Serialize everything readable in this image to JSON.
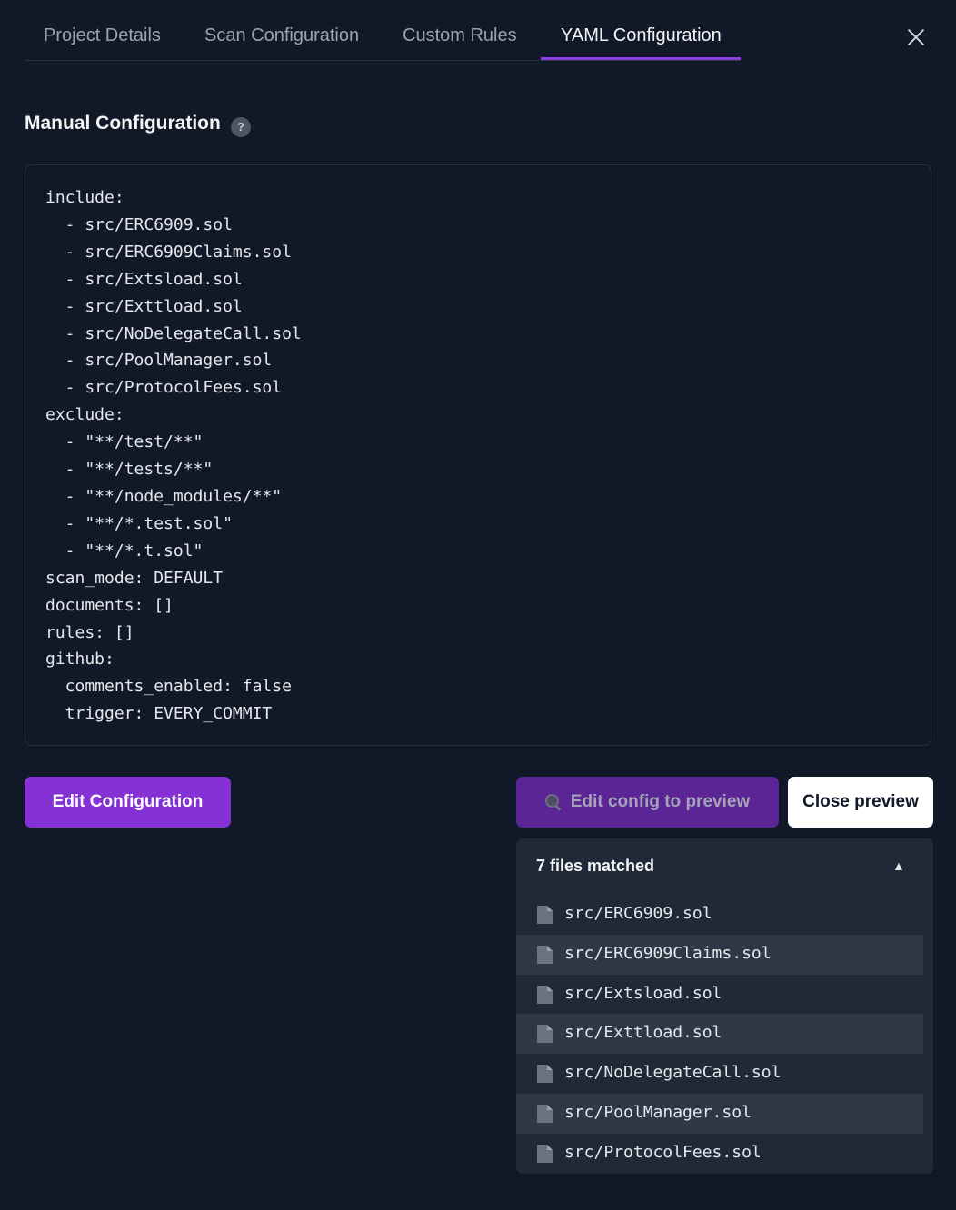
{
  "tabs": [
    {
      "label": "Project Details",
      "active": false
    },
    {
      "label": "Scan Configuration",
      "active": false
    },
    {
      "label": "Custom Rules",
      "active": false
    },
    {
      "label": "YAML Configuration",
      "active": true
    }
  ],
  "section": {
    "title": "Manual Configuration",
    "help_icon_label": "?"
  },
  "yaml_code": "include:\n  - src/ERC6909.sol\n  - src/ERC6909Claims.sol\n  - src/Extsload.sol\n  - src/Exttload.sol\n  - src/NoDelegateCall.sol\n  - src/PoolManager.sol\n  - src/ProtocolFees.sol\nexclude:\n  - \"**/test/**\"\n  - \"**/tests/**\"\n  - \"**/node_modules/**\"\n  - \"**/*.test.sol\"\n  - \"**/*.t.sol\"\nscan_mode: DEFAULT\ndocuments: []\nrules: []\ngithub:\n  comments_enabled: false\n  trigger: EVERY_COMMIT",
  "buttons": {
    "edit_configuration": "Edit Configuration",
    "edit_config_preview": "Edit config to preview",
    "close_preview": "Close preview"
  },
  "preview": {
    "title": "7 files matched",
    "toggle_icon": "▲",
    "files": [
      "src/ERC6909.sol",
      "src/ERC6909Claims.sol",
      "src/Extsload.sol",
      "src/Exttload.sol",
      "src/NoDelegateCall.sol",
      "src/PoolManager.sol",
      "src/ProtocolFees.sol"
    ]
  },
  "colors": {
    "background": "#111827",
    "accent": "#8531d6",
    "accent_muted": "#5b2596",
    "panel": "#1f2937"
  }
}
